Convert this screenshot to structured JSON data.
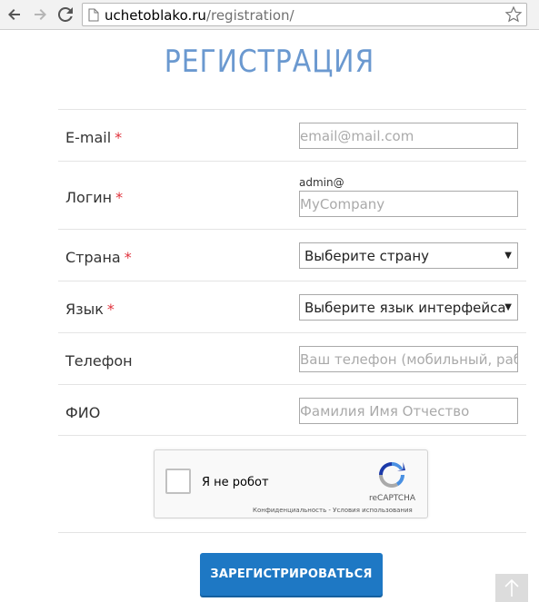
{
  "browser": {
    "url_host": "uchetoblako.ru",
    "url_path": "/registration/"
  },
  "page": {
    "title": "РЕГИСТРАЦИЯ"
  },
  "form": {
    "email": {
      "label": "E-mail",
      "required": "*",
      "placeholder": "email@mail.com"
    },
    "login": {
      "label": "Логин",
      "required": "*",
      "prefix": "admin@",
      "placeholder": "MyCompany"
    },
    "country": {
      "label": "Страна",
      "required": "*",
      "selected": "Выберите страну"
    },
    "language": {
      "label": "Язык",
      "required": "*",
      "selected": "Выберите язык интерфейса"
    },
    "phone": {
      "label": "Телефон",
      "placeholder": "Ваш телефон (мобильный, рабочий)"
    },
    "fio": {
      "label": "ФИО",
      "placeholder": "Фамилия Имя Отчество"
    }
  },
  "captcha": {
    "label": "Я не робот",
    "brand": "reCAPTCHA",
    "terms": "Конфиденциальность - Условия использования"
  },
  "submit_label": "ЗАРЕГИСТРИРОВАТЬСЯ",
  "colors": {
    "accent": "#1e78c4",
    "title": "#4a86c5",
    "required": "#e0313b"
  }
}
